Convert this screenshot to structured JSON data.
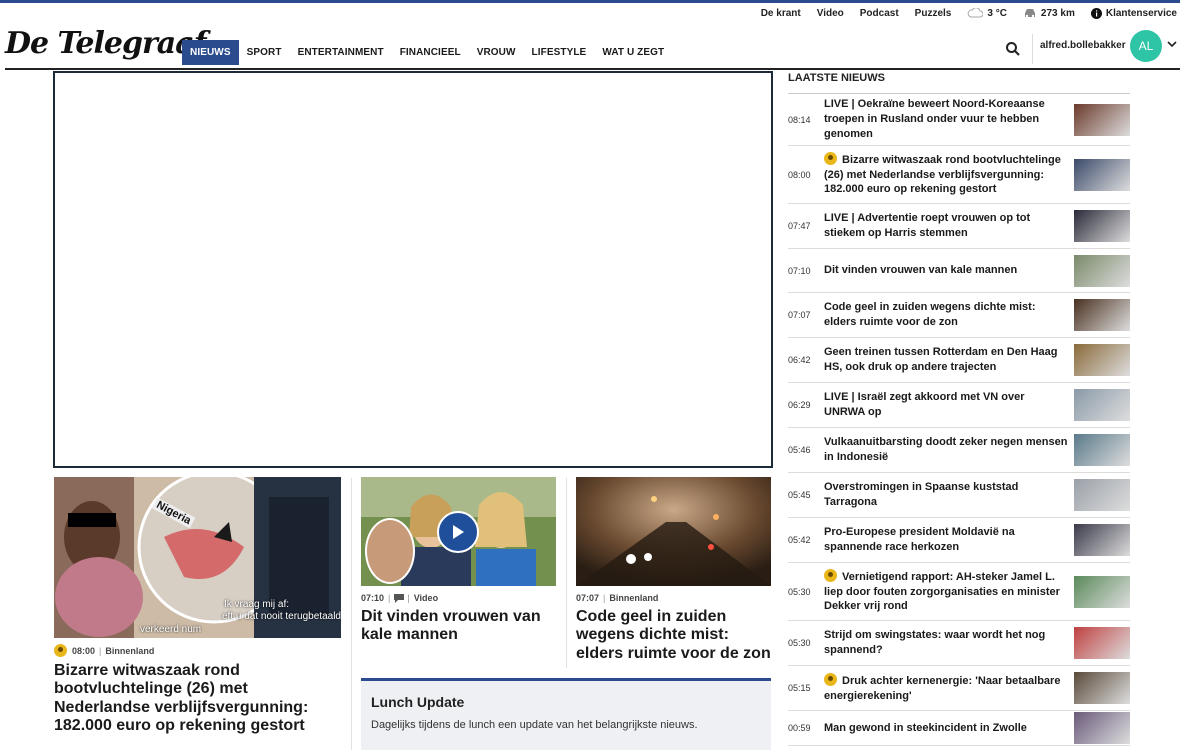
{
  "util_links": [
    "De krant",
    "Video",
    "Podcast",
    "Puzzels"
  ],
  "weather": "3 °C",
  "traffic": "273 km",
  "service": "Klantenservice",
  "logo_text": "De Telegraaf",
  "nav": [
    {
      "label": "NIEUWS",
      "active": true
    },
    {
      "label": "SPORT"
    },
    {
      "label": "ENTERTAINMENT"
    },
    {
      "label": "FINANCIEEL"
    },
    {
      "label": "VROUW"
    },
    {
      "label": "LIFESTYLE"
    },
    {
      "label": "WAT U ZEGT"
    }
  ],
  "user": {
    "name": "alfred.bollebakker",
    "initials": "AL"
  },
  "cards": {
    "main": {
      "time": "08:00",
      "section": "Binnenland",
      "title": "Bizarre witwaszaak rond bootvluchtelinge (26) met Nederlandse verblijfsvergunning: 182.000 euro op rekening gestort",
      "overlay_tag": "Nigeria",
      "subtitle1": "Ik vraag mij af:",
      "subtitle2": "eft u dat nooit terugbetaald",
      "subtitle3": "verkeerd num"
    },
    "video": {
      "time": "07:10",
      "section": "Video",
      "title": "Dit vinden vrouwen van kale mannen"
    },
    "fog": {
      "time": "07:07",
      "section": "Binnenland",
      "title": "Code geel in zuiden wegens dichte mist: elders ruimte voor de zon"
    }
  },
  "lunch": {
    "title": "Lunch Update",
    "desc": "Dagelijks tijdens de lunch een update van het belangrijkste nieuws."
  },
  "sidebar": {
    "title": "LAATSTE NIEUWS",
    "items": [
      {
        "time": "08:14",
        "text": "LIVE | Oekraïne beweert Noord-Koreaanse troepen in Rusland onder vuur te hebben genomen",
        "premium": false,
        "color": "#6b3a2a"
      },
      {
        "time": "08:00",
        "text": "Bizarre witwaszaak rond bootvluchtelinge (26) met Nederlandse verblijfsvergunning: 182.000 euro op rekening gestort",
        "premium": true,
        "color": "#3b4a6a"
      },
      {
        "time": "07:47",
        "text": "LIVE | Advertentie roept vrouwen op tot stiekem op Harris stemmen",
        "premium": false,
        "color": "#2a2a3a"
      },
      {
        "time": "07:10",
        "text": "Dit vinden vrouwen van kale mannen",
        "premium": false,
        "color": "#7a8a6a"
      },
      {
        "time": "07:07",
        "text": "Code geel in zuiden wegens dichte mist: elders ruimte voor de zon",
        "premium": false,
        "color": "#4a3020"
      },
      {
        "time": "06:42",
        "text": "Geen treinen tussen Rotterdam en Den Haag HS, ook druk op andere trajecten",
        "premium": false,
        "color": "#8a6a3a"
      },
      {
        "time": "06:29",
        "text": "LIVE | Israël zegt akkoord met VN over UNRWA op",
        "premium": false,
        "color": "#8a9aa8"
      },
      {
        "time": "05:46",
        "text": "Vulkaanuitbarsting doodt zeker negen mensen in Indonesië",
        "premium": false,
        "color": "#5a7a8a"
      },
      {
        "time": "05:45",
        "text": "Overstromingen in Spaanse kuststad Tarragona",
        "premium": false,
        "color": "#9aa0a8"
      },
      {
        "time": "05:42",
        "text": "Pro-Europese president Moldavië na spannende race herkozen",
        "premium": false,
        "color": "#3a3a4a"
      },
      {
        "time": "05:30",
        "text": "Vernietigend rapport: AH-steker Jamel L. liep door fouten zorgorganisaties en minister Dekker vrij rond",
        "premium": true,
        "color": "#5a8a5a"
      },
      {
        "time": "05:30",
        "text": "Strijd om swingstates: waar wordt het nog spannend?",
        "premium": false,
        "color": "#c04040"
      },
      {
        "time": "05:15",
        "text": "Druk achter kernenergie: 'Naar betaalbare energierekening'",
        "premium": true,
        "color": "#5a4a3a"
      },
      {
        "time": "00:59",
        "text": "Man gewond in steekincident in Zwolle",
        "premium": false,
        "color": "#6a5a7a"
      }
    ]
  }
}
